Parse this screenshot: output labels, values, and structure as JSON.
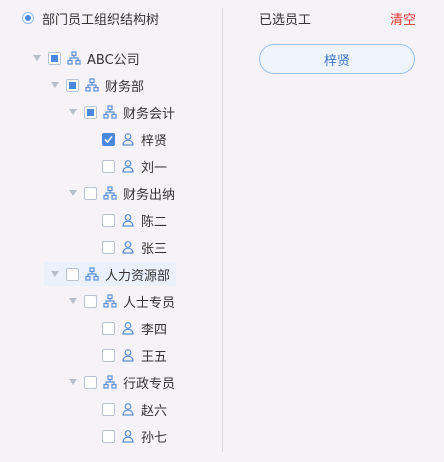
{
  "left_panel": {
    "title": "部门员工组织结构树",
    "tree": [
      {
        "label": "ABC公司",
        "type": "org",
        "level": 0,
        "expanded": true,
        "check": "partial"
      },
      {
        "label": "财务部",
        "type": "org",
        "level": 1,
        "expanded": true,
        "check": "partial"
      },
      {
        "label": "财务会计",
        "type": "org",
        "level": 2,
        "expanded": true,
        "check": "partial"
      },
      {
        "label": "梓贤",
        "type": "user",
        "level": 3,
        "check": "checked"
      },
      {
        "label": "刘一",
        "type": "user",
        "level": 3,
        "check": "none"
      },
      {
        "label": "财务出纳",
        "type": "org",
        "level": 2,
        "expanded": true,
        "check": "none"
      },
      {
        "label": "陈二",
        "type": "user",
        "level": 3,
        "check": "none"
      },
      {
        "label": "张三",
        "type": "user",
        "level": 3,
        "check": "none"
      },
      {
        "label": "人力资源部",
        "type": "org",
        "level": 1,
        "expanded": true,
        "check": "none",
        "highlight": true
      },
      {
        "label": "人士专员",
        "type": "org",
        "level": 2,
        "expanded": true,
        "check": "none"
      },
      {
        "label": "李四",
        "type": "user",
        "level": 3,
        "check": "none"
      },
      {
        "label": "王五",
        "type": "user",
        "level": 3,
        "check": "none"
      },
      {
        "label": "行政专员",
        "type": "org",
        "level": 2,
        "expanded": true,
        "check": "none"
      },
      {
        "label": "赵六",
        "type": "user",
        "level": 3,
        "check": "none"
      },
      {
        "label": "孙七",
        "type": "user",
        "level": 3,
        "check": "none"
      }
    ]
  },
  "right_panel": {
    "title": "已选员工",
    "clear_label": "清空",
    "selected": [
      "梓贤"
    ]
  },
  "colors": {
    "accent": "#4a88e0",
    "danger": "#e0362f"
  }
}
